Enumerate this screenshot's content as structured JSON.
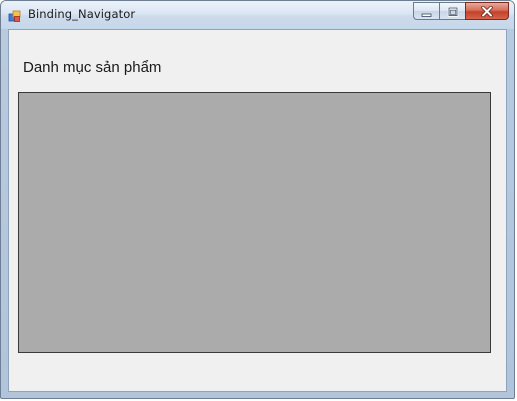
{
  "window": {
    "title": "Binding_Navigator",
    "app_icon": "winforms-app-icon"
  },
  "caption_buttons": {
    "minimize_icon": "minimize-icon",
    "maximize_icon": "maximize-icon",
    "close_icon": "close-icon"
  },
  "form": {
    "heading": "Danh mục sản phẩm",
    "grid_background": "#ababab"
  }
}
